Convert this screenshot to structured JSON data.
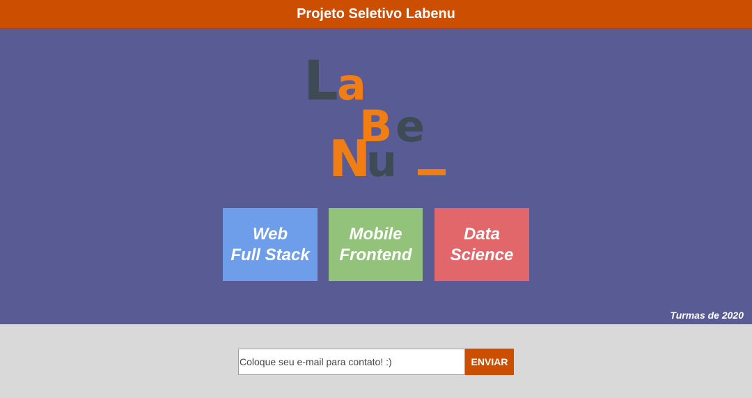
{
  "header": {
    "title": "Projeto Seletivo Labenu"
  },
  "logo": {
    "letters": [
      {
        "char": "L",
        "color": "#3e4a54"
      },
      {
        "char": "a",
        "color": "#f07e14"
      },
      {
        "char": "B",
        "color": "#f07e14"
      },
      {
        "char": "e",
        "color": "#3e4a54"
      },
      {
        "char": "N",
        "color": "#f07e14"
      },
      {
        "char": "u",
        "color": "#3e4a54"
      },
      {
        "char": "_",
        "color": "#f07e14"
      }
    ]
  },
  "courses": [
    {
      "line1": "Web",
      "line2": "Full Stack",
      "color": "#6e9ee9"
    },
    {
      "line1": "Mobile",
      "line2": "Frontend",
      "color": "#93c27a"
    },
    {
      "line1": "Data",
      "line2": "Science",
      "color": "#e2676a"
    }
  ],
  "footnote": "Turmas de 2020",
  "contact": {
    "placeholder": "Coloque seu e-mail para contato! :)",
    "value": "",
    "button_label": "ENVIAR"
  },
  "colors": {
    "header_bg": "#cc4e00",
    "main_bg": "#595c94",
    "footer_bg": "#d9d9d9",
    "logo_dark": "#3e4a54",
    "logo_orange": "#f07e14"
  }
}
